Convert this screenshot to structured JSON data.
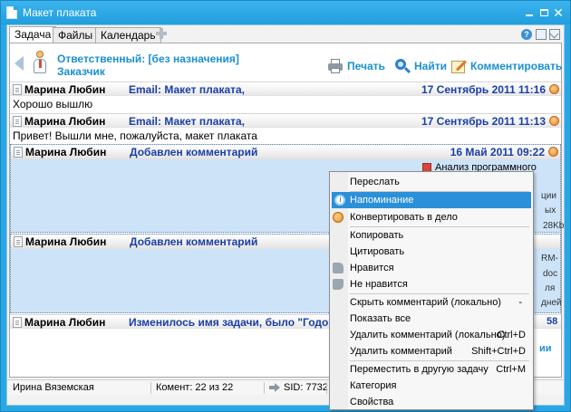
{
  "window": {
    "title": "Макет плаката"
  },
  "tabs": [
    {
      "label": "Задача"
    },
    {
      "label": "Файлы"
    },
    {
      "label": "Календарь"
    }
  ],
  "header": {
    "responsible": "Ответственный: [без назначения]",
    "customer": "Заказчик",
    "actions": {
      "print": "Печать",
      "find": "Найти",
      "comment": "Комментировать"
    }
  },
  "messages": [
    {
      "author": "Марина Любин",
      "subject": "Email: Макет плаката,",
      "date": "17 Сентябрь 2011 11:16",
      "body": "Хорошо вышлю"
    },
    {
      "author": "Марина Любин",
      "subject": "Email: Макет плаката,",
      "date": "17 Сентябрь 2011 11:13",
      "body": "Привет! Вышли мне, пожалуйста, макет плаката"
    },
    {
      "author": "Марина Любин",
      "subject": "Добавлен комментарий",
      "date": "16 Май 2011 09:22",
      "attachment": "Анализ программного"
    },
    {
      "author": "Марина Любин",
      "subject": "Добавлен комментарий"
    },
    {
      "author": "Марина Любин",
      "subject": "Изменилось имя задачи, было \"Годовой"
    }
  ],
  "peeks": {
    "a": "ции",
    "b": "ых",
    "c": "28Kb",
    "d": "RM-",
    "e": "doc",
    "f": "ля",
    "g": "дней",
    "h": "58",
    "link": "ии"
  },
  "context_menu": {
    "items": [
      {
        "label": "Переслать",
        "shortcut": ""
      },
      {
        "label": "Напоминание",
        "shortcut": "",
        "icon": "clock-icon",
        "highlighted": true
      },
      {
        "label": "Конвертировать в дело",
        "shortcut": "",
        "icon": "badge-icon"
      },
      {
        "label": "Копировать",
        "shortcut": ""
      },
      {
        "label": "Цитировать",
        "shortcut": ""
      },
      {
        "label": "Нравится",
        "shortcut": "",
        "icon": "thumbs-up-icon"
      },
      {
        "label": "Не нравится",
        "shortcut": "",
        "icon": "thumbs-down-icon"
      },
      {
        "label": "Скрыть комментарий (локально)",
        "shortcut": "-"
      },
      {
        "label": "Показать все",
        "shortcut": ""
      },
      {
        "label": "Удалить комментарий (локально)",
        "shortcut": "Ctrl+D"
      },
      {
        "label": "Удалить комментарий",
        "shortcut": "Shift+Ctrl+D"
      },
      {
        "label": "Переместить в другую задачу",
        "shortcut": "Ctrl+M"
      },
      {
        "label": "Категория",
        "shortcut": ""
      },
      {
        "label": "Свойства",
        "shortcut": ""
      }
    ]
  },
  "status_bar": {
    "user": "Ирина Вяземская",
    "comments": "Комент: 22 из 22",
    "sid": "SID: 7732"
  }
}
